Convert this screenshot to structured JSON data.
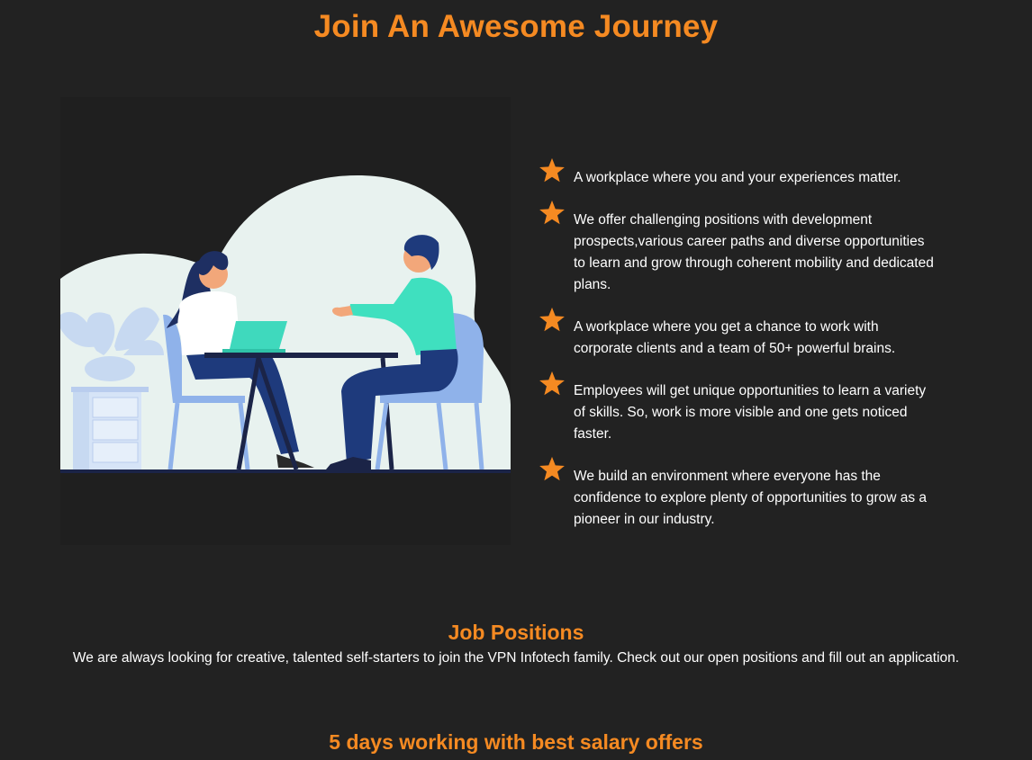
{
  "hero": {
    "title": "Join An Awesome Journey"
  },
  "features": [
    {
      "icon": "star-icon",
      "text": "A workplace where you and your experiences matter."
    },
    {
      "icon": "star-icon",
      "text": "We offer challenging positions with development prospects,various career paths and diverse opportunities to learn and grow through coherent mobility and dedicated plans."
    },
    {
      "icon": "star-icon",
      "text": "A workplace where you get a chance to work with corporate clients and a team of 50+ powerful brains."
    },
    {
      "icon": "star-icon",
      "text": "Employees will get unique opportunities to learn a variety of skills. So, work is more visible and one gets noticed faster."
    },
    {
      "icon": "star-icon",
      "text": "We build an environment where everyone has the confidence to explore plenty of opportunities to grow as a pioneer in our industry."
    }
  ],
  "jobs": {
    "title": "Job Positions",
    "description": "We are always looking for creative, talented self-starters to join the VPN Infotech family. Check out our open positions and fill out an application."
  },
  "salary": {
    "title": "5 days working with best salary offers"
  },
  "colors": {
    "accent": "#f58a22",
    "background": "#222222",
    "text": "#ffffff"
  }
}
